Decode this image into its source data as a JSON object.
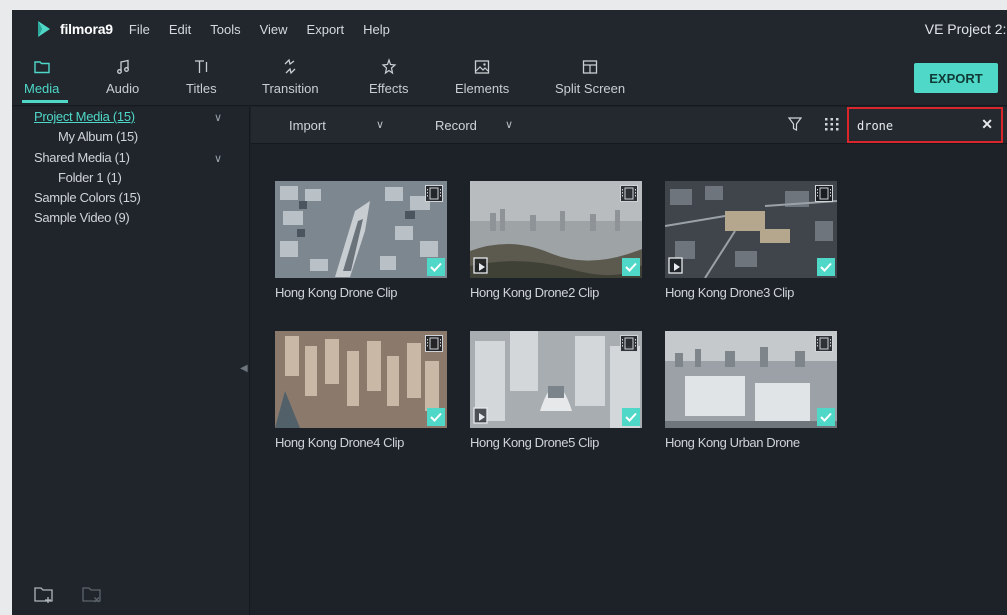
{
  "app": {
    "name": "filmora9",
    "project_title": "VE Project 2: (",
    "accent_color": "#4fd8c8",
    "highlight_color": "#d9262b"
  },
  "menu": [
    "File",
    "Edit",
    "Tools",
    "View",
    "Export",
    "Help"
  ],
  "toolbar": {
    "tabs": [
      {
        "label": "Media",
        "icon": "folder-icon",
        "active": true
      },
      {
        "label": "Audio",
        "icon": "music-note-icon"
      },
      {
        "label": "Titles",
        "icon": "text-icon"
      },
      {
        "label": "Transition",
        "icon": "transition-icon"
      },
      {
        "label": "Effects",
        "icon": "effects-icon"
      },
      {
        "label": "Elements",
        "icon": "image-icon"
      },
      {
        "label": "Split Screen",
        "icon": "split-screen-icon"
      }
    ],
    "export_label": "EXPORT"
  },
  "sidebar": {
    "items": [
      {
        "label": "Project Media (15)",
        "selected": true
      },
      {
        "label": "My Album (15)"
      },
      {
        "label": "Shared Media (1)"
      },
      {
        "label": "Folder 1 (1)"
      },
      {
        "label": "Sample Colors (15)"
      },
      {
        "label": "Sample Video (9)"
      }
    ]
  },
  "media_toolbar": {
    "import_label": "Import",
    "record_label": "Record",
    "search_value": "drone"
  },
  "clips": [
    {
      "name": "Hong Kong Drone Clip"
    },
    {
      "name": "Hong Kong Drone2 Clip"
    },
    {
      "name": "Hong Kong Drone3 Clip"
    },
    {
      "name": "Hong Kong Drone4 Clip"
    },
    {
      "name": "Hong Kong Drone5 Clip"
    },
    {
      "name": "Hong Kong Urban Drone"
    }
  ]
}
